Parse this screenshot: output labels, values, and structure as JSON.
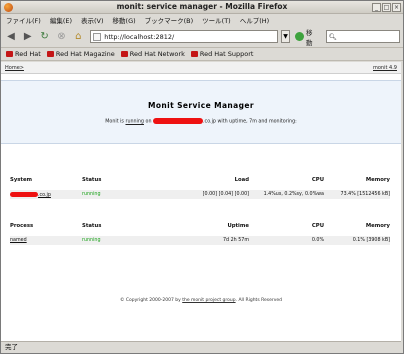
{
  "window": {
    "title": "monit: service manager - Mozilla Firefox"
  },
  "menu": [
    "ファイル(F)",
    "編集(E)",
    "表示(V)",
    "移動(G)",
    "ブックマーク(B)",
    "ツール(T)",
    "ヘルプ(H)"
  ],
  "nav": {
    "url": "http://localhost:2812/",
    "go_label": "移動",
    "search_placeholder": ""
  },
  "bookmarks": [
    "Red Hat",
    "Red Hat Magazine",
    "Red Hat Network",
    "Red Hat Support"
  ],
  "page": {
    "breadcrumb": "Home>",
    "version": "monit 4.9",
    "heading": "Monit Service Manager",
    "subtitle_prefix": "Monit is",
    "subtitle_link": "running",
    "subtitle_on": "on",
    "subtitle_suffix": ".co.jp with uptime, 7m and monitoring:",
    "system_table": {
      "headers": [
        "System",
        "Status",
        "Load",
        "CPU",
        "Memory"
      ],
      "rows": [
        {
          "name_suffix": ".co.jp",
          "status": "running",
          "load": "[0.00] [0.04] [0.00]",
          "cpu": "1.4%us, 0.2%sy, 0.0%wa",
          "memory": "73.4% [1512456 kB]"
        }
      ]
    },
    "process_table": {
      "headers": [
        "Process",
        "Status",
        "Uptime",
        "CPU",
        "Memory"
      ],
      "rows": [
        {
          "name": "named",
          "status": "running",
          "uptime": "7d 2h 57m",
          "cpu": "0.0%",
          "memory": "0.1% [3908 kB]"
        }
      ]
    },
    "footer_prefix": "© Copyright 2000-2007 by",
    "footer_link": "the monit project group",
    "footer_suffix": ". All Rights Reserved"
  },
  "status_bar": "完了",
  "colors": {
    "running": "#19a319",
    "redaction": "#ee1111",
    "hero_bg": "#eef4fb"
  }
}
